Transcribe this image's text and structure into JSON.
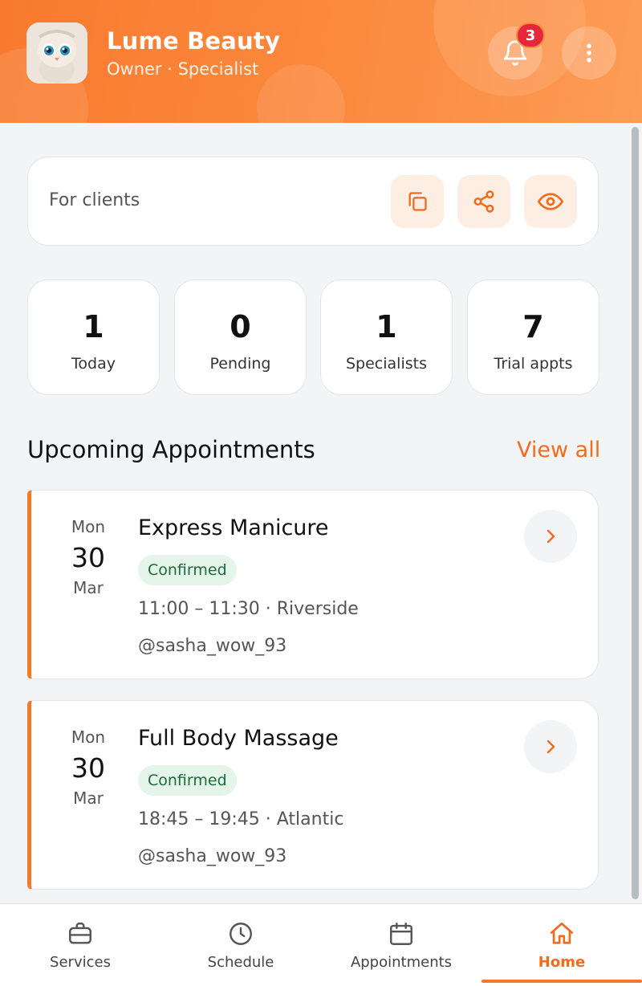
{
  "header": {
    "title": "Lume Beauty",
    "subtitle": "Owner · Specialist",
    "notification_count": "3"
  },
  "clients": {
    "label": "For clients"
  },
  "stats": [
    {
      "value": "1",
      "label": "Today"
    },
    {
      "value": "0",
      "label": "Pending"
    },
    {
      "value": "1",
      "label": "Specialists"
    },
    {
      "value": "7",
      "label": "Trial appts"
    }
  ],
  "upcoming": {
    "title": "Upcoming Appointments",
    "view_all": "View all",
    "items": [
      {
        "dow": "Mon",
        "day": "30",
        "month": "Mar",
        "service": "Express Manicure",
        "status": "Confirmed",
        "time": "11:00 – 11:30 · Riverside",
        "client": "@sasha_wow_93"
      },
      {
        "dow": "Mon",
        "day": "30",
        "month": "Mar",
        "service": "Full Body Massage",
        "status": "Confirmed",
        "time": "18:45 – 19:45 · Atlantic",
        "client": "@sasha_wow_93"
      }
    ]
  },
  "nav": {
    "items": [
      {
        "label": "Services",
        "icon": "briefcase-icon"
      },
      {
        "label": "Schedule",
        "icon": "clock-icon"
      },
      {
        "label": "Appointments",
        "icon": "calendar-icon"
      },
      {
        "label": "Home",
        "icon": "home-icon"
      }
    ],
    "active": "Home"
  },
  "colors": {
    "accent": "#f47a2b",
    "status_confirmed": "#1c6b3a"
  }
}
